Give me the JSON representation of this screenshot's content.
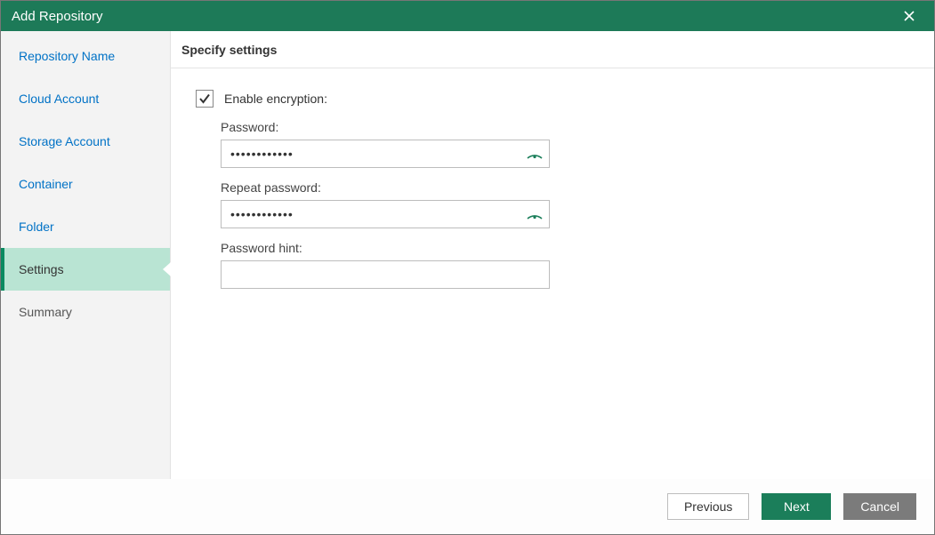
{
  "titlebar": {
    "title": "Add Repository"
  },
  "sidebar": {
    "steps": [
      {
        "label": "Repository Name",
        "state": "past"
      },
      {
        "label": "Cloud Account",
        "state": "past"
      },
      {
        "label": "Storage Account",
        "state": "past"
      },
      {
        "label": "Container",
        "state": "past"
      },
      {
        "label": "Folder",
        "state": "past"
      },
      {
        "label": "Settings",
        "state": "current"
      },
      {
        "label": "Summary",
        "state": "after"
      }
    ]
  },
  "content": {
    "heading": "Specify settings",
    "enable_encryption_label": "Enable encryption:",
    "enable_encryption_checked": true,
    "password_label": "Password:",
    "password_value": "••••••••••••",
    "repeat_password_label": "Repeat password:",
    "repeat_password_value": "••••••••••••",
    "password_hint_label": "Password hint:",
    "password_hint_value": ""
  },
  "footer": {
    "previous": "Previous",
    "next": "Next",
    "cancel": "Cancel"
  },
  "colors": {
    "accent": "#1d7a58",
    "link": "#0072c6",
    "sidebar_current_bg": "#b9e4d3"
  }
}
